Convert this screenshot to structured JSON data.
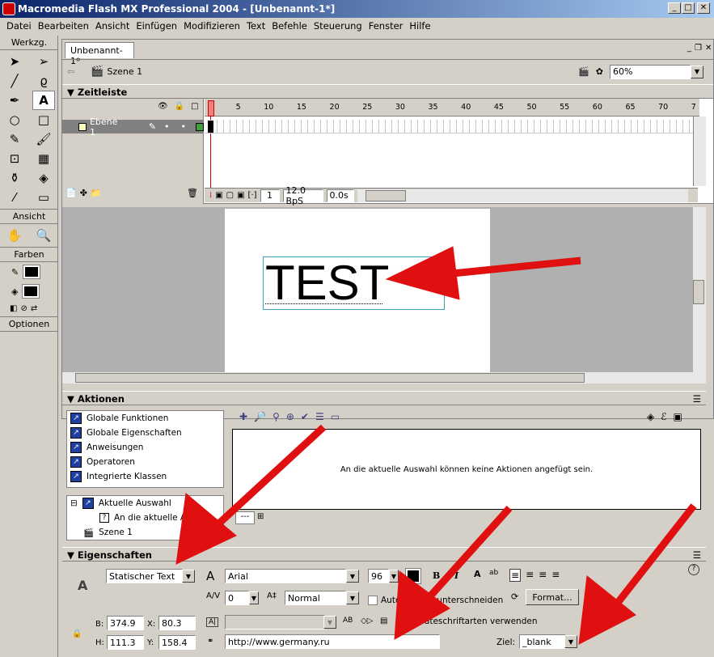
{
  "window": {
    "title": "Macromedia Flash MX Professional 2004 - [Unbenannt-1*]",
    "min": "_",
    "max": "□",
    "close": "✕"
  },
  "menu": [
    "Datei",
    "Bearbeiten",
    "Ansicht",
    "Einfügen",
    "Modifizieren",
    "Text",
    "Befehle",
    "Steuerung",
    "Fenster",
    "Hilfe"
  ],
  "tools": {
    "werkzeuge": "Werkzg.",
    "ansicht": "Ansicht",
    "farben": "Farben",
    "optionen": "Optionen"
  },
  "document": {
    "tab": "Unbenannt-1*",
    "scene": "Szene 1",
    "zoom": "60%"
  },
  "timeline": {
    "title": "Zeitleiste",
    "layer": "Ebene 1",
    "frame_numbers": [
      "1",
      "5",
      "10",
      "15",
      "20",
      "25",
      "30",
      "35",
      "40",
      "45",
      "50",
      "55",
      "60",
      "65",
      "70",
      "7"
    ],
    "current_frame": "1",
    "fps": "12.0 BpS",
    "time": "0.0s"
  },
  "stage": {
    "text": "TEST"
  },
  "actions": {
    "title": "Aktionen",
    "categories": [
      "Globale Funktionen",
      "Globale Eigenschaften",
      "Anweisungen",
      "Operatoren",
      "Integrierte Klassen"
    ],
    "tree_selection": "Aktuelle Auswahl",
    "tree_child": "An die aktuelle Auswa",
    "tree_scene": "Szene 1",
    "message": "An die aktuelle Auswahl können keine Aktionen angefügt sein.",
    "tab": "---"
  },
  "properties": {
    "title": "Eigenschaften",
    "text_type": "Statischer Text",
    "font": "Arial",
    "font_size": "96",
    "letter_spacing": "0",
    "baseline": "Normal",
    "auto_kern": "Automatisch unterschneiden",
    "format_button": "Format...",
    "device_fonts": "Geräteschriftarten verwenden",
    "w_label": "B:",
    "w": "374.9",
    "x_label": "X:",
    "x": "80.3",
    "h_label": "H:",
    "h": "111.3",
    "y_label": "Y:",
    "y": "158.4",
    "url": "http://www.germany.ru",
    "target_label": "Ziel:",
    "target": "_blank"
  },
  "colors": {
    "arrow": "#e01010",
    "accent": "#0a246a"
  }
}
